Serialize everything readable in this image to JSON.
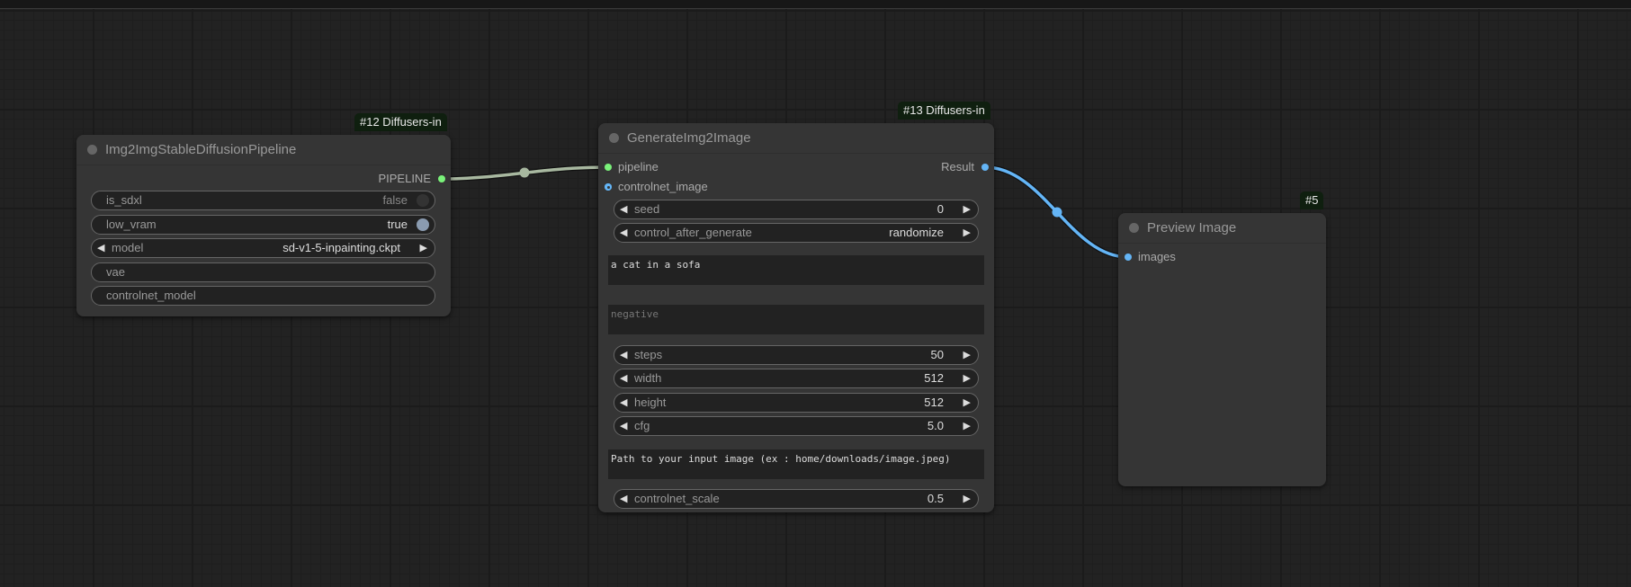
{
  "canvas": {
    "background": "#222222"
  },
  "colors": {
    "pipeline_link": "#a8b8a0",
    "image_link": "#64b5f6",
    "slot_green": "#7af27a",
    "slot_blue": "#64b5f6",
    "badge_bg": "#0f1f0f"
  },
  "nodes": {
    "pipeline_node": {
      "badge": "#12 Diffusers-in",
      "title": "Img2ImgStableDiffusionPipeline",
      "outputs": [
        {
          "label": "PIPELINE",
          "type": "green"
        }
      ],
      "widgets": {
        "is_sdxl": {
          "label": "is_sdxl",
          "value": "false"
        },
        "low_vram": {
          "label": "low_vram",
          "value": "true"
        },
        "model": {
          "label": "model",
          "value": "sd-v1-5-inpainting.ckpt"
        },
        "vae": {
          "label": "vae"
        },
        "controlnet_model": {
          "label": "controlnet_model"
        }
      }
    },
    "generate_node": {
      "badge": "#13 Diffusers-in",
      "title": "GenerateImg2Image",
      "inputs": {
        "pipeline": {
          "label": "pipeline"
        },
        "controlnet_image": {
          "label": "controlnet_image"
        }
      },
      "outputs": {
        "result": {
          "label": "Result"
        }
      },
      "widgets": {
        "seed": {
          "label": "seed",
          "value": "0"
        },
        "control_after_generate": {
          "label": "control_after_generate",
          "value": "randomize"
        },
        "prompt": {
          "value": "a cat in a sofa"
        },
        "negative": {
          "placeholder": "negative"
        },
        "steps": {
          "label": "steps",
          "value": "50"
        },
        "width": {
          "label": "width",
          "value": "512"
        },
        "height": {
          "label": "height",
          "value": "512"
        },
        "cfg": {
          "label": "cfg",
          "value": "5.0"
        },
        "image_path": {
          "value": "Path to your input image (ex : home/downloads/image.jpeg)"
        },
        "controlnet_scale": {
          "label": "controlnet_scale",
          "value": "0.5"
        }
      }
    },
    "preview_node": {
      "badge": "#5",
      "title": "Preview Image",
      "inputs": {
        "images": {
          "label": "images"
        }
      }
    }
  },
  "icons": {
    "arrow_left": "◀",
    "arrow_right": "▶"
  }
}
